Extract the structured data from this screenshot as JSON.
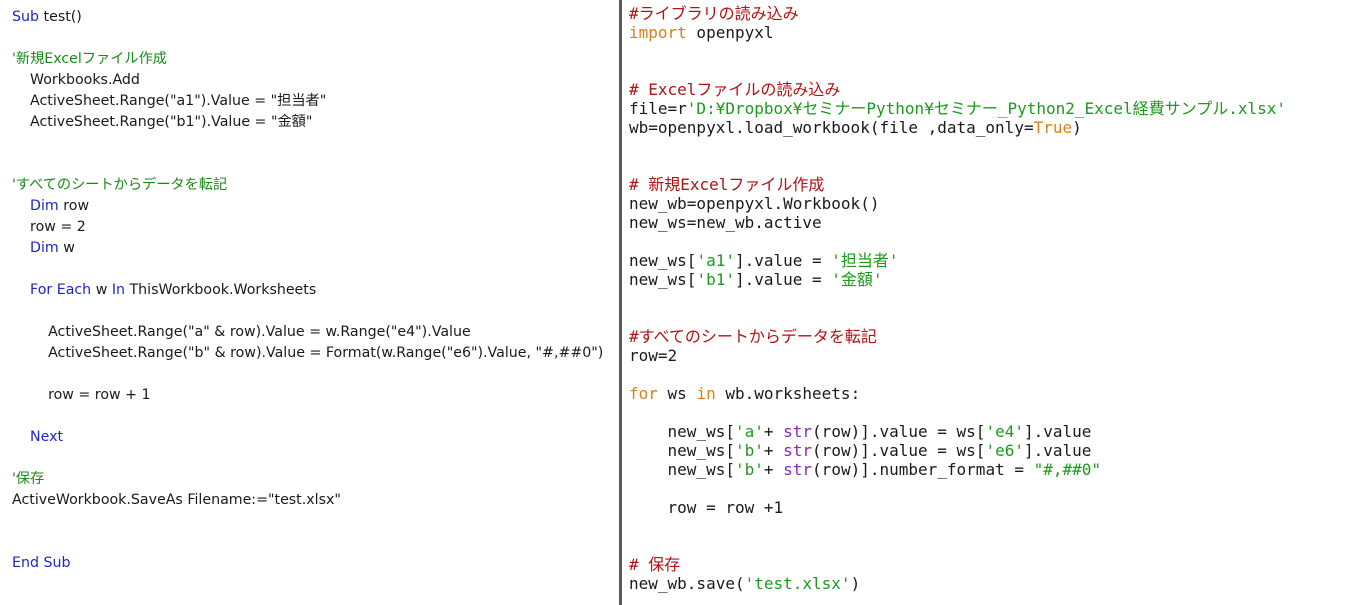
{
  "vba": {
    "lines": [
      {
        "indent": "",
        "tokens": [
          {
            "t": "Sub",
            "k": "kw"
          },
          {
            "t": " test()",
            "k": ""
          }
        ]
      },
      {
        "indent": "",
        "tokens": [
          {
            "t": "'新規Excelファイル作成",
            "k": "cm"
          }
        ]
      },
      {
        "indent": "    ",
        "tokens": [
          {
            "t": "Workbooks.Add",
            "k": ""
          }
        ]
      },
      {
        "indent": "    ",
        "tokens": [
          {
            "t": "ActiveSheet.Range(\"a1\").Value = \"担当者\"",
            "k": ""
          }
        ]
      },
      {
        "indent": "    ",
        "tokens": [
          {
            "t": "ActiveSheet.Range(\"b1\").Value = \"金額\"",
            "k": ""
          }
        ]
      },
      {
        "indent": "",
        "tokens": [
          {
            "t": "'すべてのシートからデータを転記",
            "k": "cm"
          }
        ]
      },
      {
        "indent": "    ",
        "tokens": [
          {
            "t": "Dim",
            "k": "kw"
          },
          {
            "t": " row",
            "k": ""
          }
        ]
      },
      {
        "indent": "    ",
        "tokens": [
          {
            "t": "row = 2",
            "k": ""
          }
        ]
      },
      {
        "indent": "    ",
        "tokens": [
          {
            "t": "Dim",
            "k": "kw"
          },
          {
            "t": " w",
            "k": ""
          }
        ]
      },
      {
        "indent": "    ",
        "tokens": [
          {
            "t": "For Each",
            "k": "kw"
          },
          {
            "t": " w ",
            "k": ""
          },
          {
            "t": "In",
            "k": "kw"
          },
          {
            "t": " ThisWorkbook.Worksheets",
            "k": ""
          }
        ]
      },
      {
        "indent": "        ",
        "tokens": [
          {
            "t": "ActiveSheet.Range(\"a\" & row).Value = w.Range(\"e4\").Value",
            "k": ""
          }
        ]
      },
      {
        "indent": "        ",
        "tokens": [
          {
            "t": "ActiveSheet.Range(\"b\" & row).Value = Format(w.Range(\"e6\").Value, \"#,##0\")",
            "k": ""
          }
        ]
      },
      {
        "indent": "        ",
        "tokens": [
          {
            "t": "row = row + 1",
            "k": ""
          }
        ]
      },
      {
        "indent": "    ",
        "tokens": [
          {
            "t": "Next",
            "k": "kw"
          }
        ]
      },
      {
        "indent": "",
        "tokens": [
          {
            "t": "'保存",
            "k": "cm"
          }
        ]
      },
      {
        "indent": "",
        "tokens": [
          {
            "t": "ActiveWorkbook.SaveAs Filename:=\"test.xlsx\"",
            "k": ""
          }
        ]
      },
      {
        "indent": "",
        "tokens": [
          {
            "t": "End Sub",
            "k": "kw"
          }
        ]
      }
    ]
  },
  "python": {
    "lines": [
      {
        "tokens": [
          {
            "t": "#ライブラリの読み込み",
            "k": "cm"
          }
        ]
      },
      {
        "tokens": [
          {
            "t": "import",
            "k": "kw"
          },
          {
            "t": " openpyxl",
            "k": ""
          }
        ]
      },
      {
        "tokens": [
          {
            "t": "# Excelファイルの読み込み",
            "k": "cm"
          }
        ]
      },
      {
        "tokens": [
          {
            "t": "file=r",
            "k": ""
          },
          {
            "t": "'D:¥Dropbox¥セミナーPython¥セミナー_Python2_Excel経費サンプル.xlsx'",
            "k": "st"
          }
        ]
      },
      {
        "tokens": [
          {
            "t": "wb=openpyxl.load_workbook(file ,data_only=",
            "k": ""
          },
          {
            "t": "True",
            "k": "kw"
          },
          {
            "t": ")",
            "k": ""
          }
        ]
      },
      {
        "tokens": [
          {
            "t": "# 新規Excelファイル作成",
            "k": "cm"
          }
        ]
      },
      {
        "tokens": [
          {
            "t": "new_wb=openpyxl.Workbook()",
            "k": ""
          }
        ]
      },
      {
        "tokens": [
          {
            "t": "new_ws=new_wb.active",
            "k": ""
          }
        ]
      },
      {
        "tokens": [
          {
            "t": "new_ws[",
            "k": ""
          },
          {
            "t": "'a1'",
            "k": "st"
          },
          {
            "t": "].value = ",
            "k": ""
          },
          {
            "t": "'担当者'",
            "k": "st"
          }
        ]
      },
      {
        "tokens": [
          {
            "t": "new_ws[",
            "k": ""
          },
          {
            "t": "'b1'",
            "k": "st"
          },
          {
            "t": "].value = ",
            "k": ""
          },
          {
            "t": "'金額'",
            "k": "st"
          }
        ]
      },
      {
        "tokens": [
          {
            "t": "#すべてのシートからデータを転記",
            "k": "cm"
          }
        ]
      },
      {
        "tokens": [
          {
            "t": "row=2",
            "k": ""
          }
        ]
      },
      {
        "tokens": [
          {
            "t": "for",
            "k": "kw"
          },
          {
            "t": " ws ",
            "k": ""
          },
          {
            "t": "in",
            "k": "kw"
          },
          {
            "t": " wb.worksheets:",
            "k": ""
          }
        ]
      },
      {
        "tokens": [
          {
            "t": "    new_ws[",
            "k": ""
          },
          {
            "t": "'a'",
            "k": "st"
          },
          {
            "t": "+ ",
            "k": ""
          },
          {
            "t": "str",
            "k": "bi"
          },
          {
            "t": "(row)].value = ws[",
            "k": ""
          },
          {
            "t": "'e4'",
            "k": "st"
          },
          {
            "t": "].value",
            "k": ""
          }
        ]
      },
      {
        "tokens": [
          {
            "t": "    new_ws[",
            "k": ""
          },
          {
            "t": "'b'",
            "k": "st"
          },
          {
            "t": "+ ",
            "k": ""
          },
          {
            "t": "str",
            "k": "bi"
          },
          {
            "t": "(row)].value = ws[",
            "k": ""
          },
          {
            "t": "'e6'",
            "k": "st"
          },
          {
            "t": "].value",
            "k": ""
          }
        ]
      },
      {
        "tokens": [
          {
            "t": "    new_ws[",
            "k": ""
          },
          {
            "t": "'b'",
            "k": "st"
          },
          {
            "t": "+ ",
            "k": ""
          },
          {
            "t": "str",
            "k": "bi"
          },
          {
            "t": "(row)].number_format = ",
            "k": ""
          },
          {
            "t": "\"#,##0\"",
            "k": "st"
          }
        ]
      },
      {
        "tokens": [
          {
            "t": "    row = row +1",
            "k": ""
          }
        ]
      },
      {
        "tokens": [
          {
            "t": "# 保存",
            "k": "cm"
          }
        ]
      },
      {
        "tokens": [
          {
            "t": "new_wb.save(",
            "k": ""
          },
          {
            "t": "'test.xlsx'",
            "k": "st"
          },
          {
            "t": ")",
            "k": ""
          }
        ]
      }
    ]
  },
  "colors": {
    "vba_keyword": "#1f26c8",
    "vba_comment": "#1a8a1a",
    "py_comment": "#b31212",
    "py_keyword": "#d9801a",
    "py_string": "#1d9a1d",
    "py_builtin": "#8a28b8"
  }
}
